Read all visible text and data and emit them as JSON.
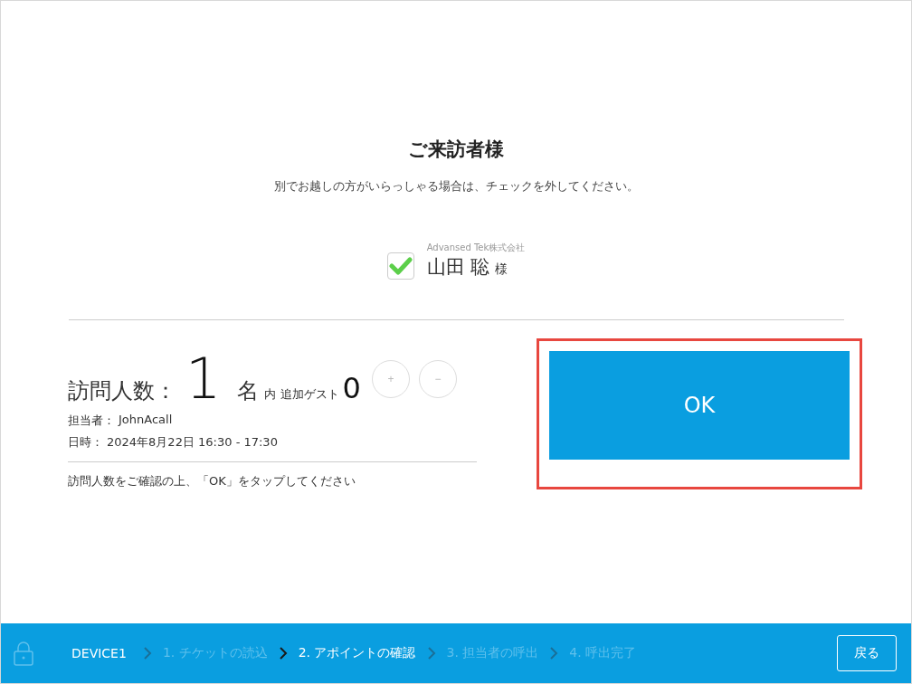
{
  "header": {
    "title": "ご来訪者様",
    "subtitle": "別でお越しの方がいらっしゃる場合は、チェックを外してください。"
  },
  "visitors": [
    {
      "company": "Advansed Tek株式会社",
      "name": "山田 聡",
      "honorific": "様",
      "checked": true
    }
  ],
  "count": {
    "label": "訪問人数：",
    "value": "1",
    "unit": "名",
    "guest_label": "内 追加ゲスト",
    "guest_value": "0",
    "plus": "+",
    "minus": "−"
  },
  "details": [
    {
      "label": "担当者：",
      "value": "JohnAcall"
    },
    {
      "label": "日時：",
      "value": "2024年8月22日 16:30 - 17:30"
    }
  ],
  "instruction": "訪問人数をご確認の上、「OK」をタップしてください",
  "ok_button": {
    "label": "OK",
    "highlighted": true
  },
  "footer": {
    "device": "DEVICE1",
    "steps": [
      {
        "label": "1. チケットの読込",
        "selected": false
      },
      {
        "label": "2. アポイントの確認",
        "selected": true
      },
      {
        "label": "3. 担当者の呼出",
        "selected": false
      },
      {
        "label": "4. 呼出完了",
        "selected": false
      }
    ],
    "back": "戻る"
  }
}
